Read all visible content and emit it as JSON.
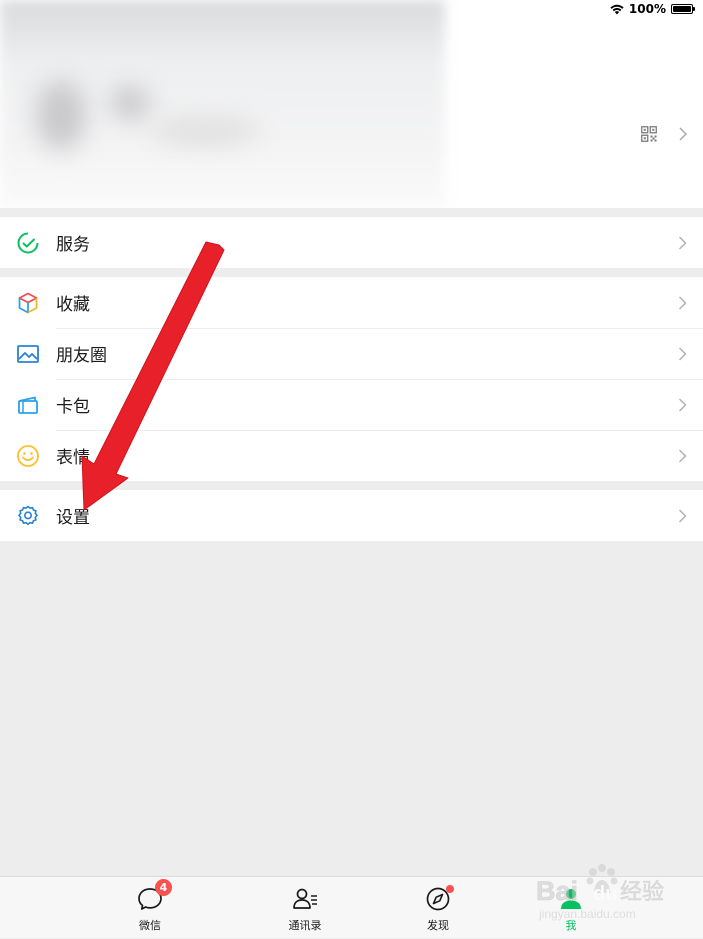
{
  "status_bar": {
    "battery": "100%",
    "battery_level": 1.0
  },
  "profile": {
    "qr_icon": "qr-code-icon",
    "chevron_icon": "chevron-right-icon"
  },
  "menu": {
    "services": {
      "label": "服务",
      "icon": "services-check-icon",
      "color": "#07c160"
    },
    "favorites": {
      "label": "收藏",
      "icon": "favorites-cube-icon"
    },
    "moments": {
      "label": "朋友圈",
      "icon": "moments-photo-icon",
      "color": "#2782d7"
    },
    "cards": {
      "label": "卡包",
      "icon": "card-wallet-icon",
      "color": "#2aa2e8"
    },
    "stickers": {
      "label": "表情",
      "icon": "smiley-sticker-icon",
      "color": "#f7c22b"
    },
    "settings": {
      "label": "设置",
      "icon": "gear-icon",
      "color": "#2782d7"
    }
  },
  "tabbar": {
    "chats": {
      "label": "微信",
      "badge": "4",
      "icon": "chat-bubble-icon"
    },
    "contacts": {
      "label": "通讯录",
      "icon": "contacts-icon"
    },
    "discover": {
      "label": "发现",
      "icon": "compass-icon"
    },
    "me": {
      "label": "我",
      "icon": "person-icon",
      "active": true
    }
  },
  "colors": {
    "accent": "#07c160",
    "badge": "#fa5151",
    "annotation_arrow": "#e8202a",
    "background": "#ededed"
  },
  "watermark": {
    "brand": "Bai",
    "brand_tail": "du",
    "service": "经验",
    "url": "jingyan.baidu.com"
  }
}
